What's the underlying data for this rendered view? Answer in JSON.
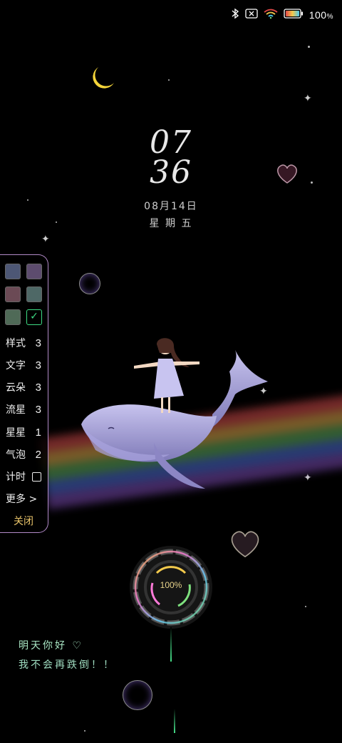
{
  "status_bar": {
    "bluetooth_icon": "bluetooth-icon",
    "sim_icon": "no-sim-icon",
    "wifi_icon": "wifi-icon",
    "battery_icon": "battery-icon",
    "battery_percent": "100",
    "battery_unit": "%"
  },
  "clock": {
    "hour": "07",
    "minute": "36",
    "date": "08月14日",
    "weekday": "星 期 五"
  },
  "panel": {
    "swatch_colors": [
      "#4d5775",
      "#5d4c6e",
      "#6b4a55",
      "#4e6866",
      "#4f6a57"
    ],
    "checked_swatch_icon": "check-icon",
    "settings": [
      {
        "label": "样式",
        "value": "3"
      },
      {
        "label": "文字",
        "value": "3"
      },
      {
        "label": "云朵",
        "value": "3"
      },
      {
        "label": "流星",
        "value": "3"
      },
      {
        "label": "星星",
        "value": "1"
      },
      {
        "label": "气泡",
        "value": "2"
      }
    ],
    "timer_label": "计时",
    "more_label": "更多 >",
    "close_label": "关闭"
  },
  "progress": {
    "value_text": "100%",
    "fraction": 1.0
  },
  "message": {
    "line1": "明天你好 ♡",
    "line2": "我不会再跌倒！！"
  },
  "colors": {
    "accent_check": "#3ddc84",
    "panel_border": "#b28ac8",
    "close_text": "#e9c46a",
    "message_text": "#a9e6c4"
  }
}
